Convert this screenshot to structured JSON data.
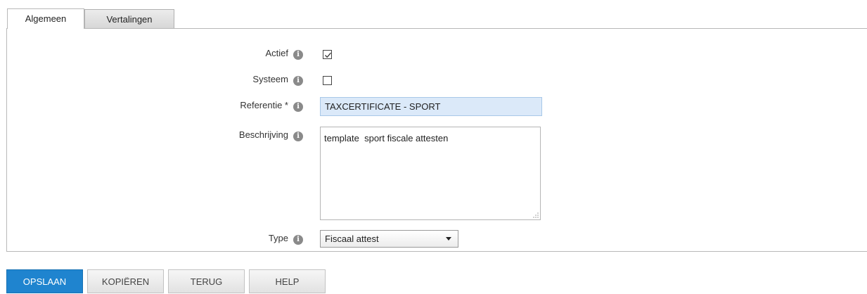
{
  "tabs": [
    {
      "label": "Algemeen",
      "active": true
    },
    {
      "label": "Vertalingen",
      "active": false
    }
  ],
  "form": {
    "actief": {
      "label": "Actief",
      "checked": true
    },
    "systeem": {
      "label": "Systeem",
      "checked": false
    },
    "referentie": {
      "label": "Referentie *",
      "value": "TAXCERTIFICATE - SPORT"
    },
    "beschrijving": {
      "label": "Beschrijving",
      "value": "template  sport fiscale attesten"
    },
    "type": {
      "label": "Type",
      "selected": "Fiscaal attest"
    }
  },
  "info_icon": "i",
  "buttons": {
    "save": "OPSLAAN",
    "copy": "KOPIËREN",
    "back": "TERUG",
    "help": "HELP"
  },
  "colors": {
    "primary": "#1f84cf",
    "input_highlight": "#dbe9f9"
  }
}
